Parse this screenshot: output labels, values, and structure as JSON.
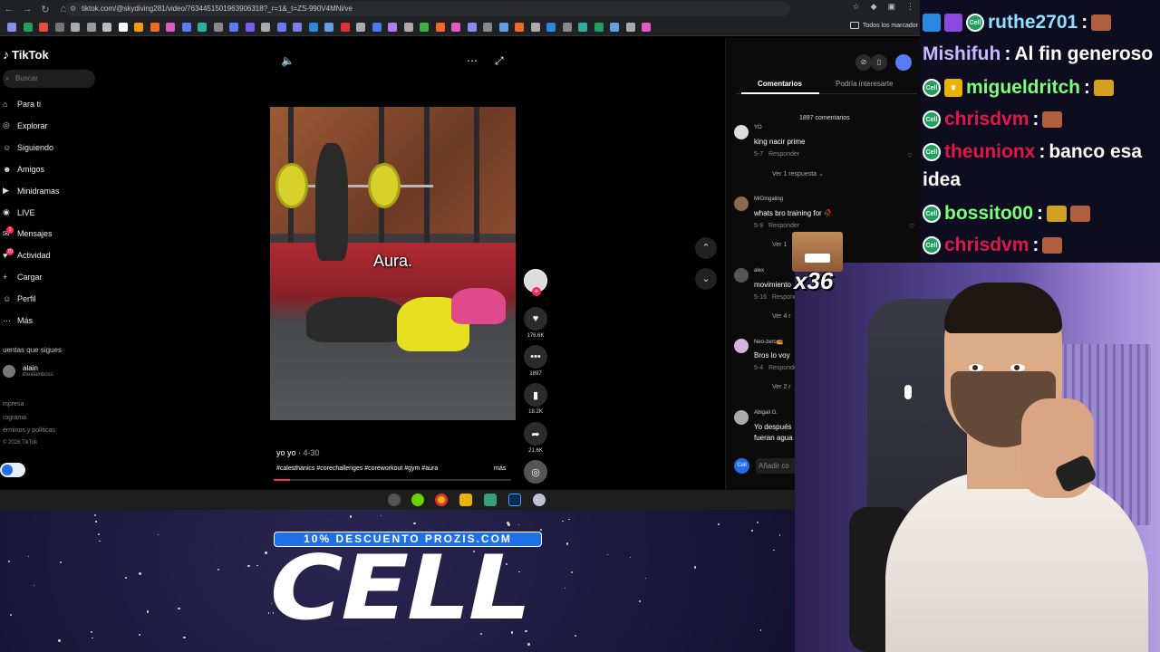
{
  "browser": {
    "url": "tiktok.com/@skydiving281/video/7634451501963906318?_r=1&_t=ZS-990V4MNi/ve",
    "bookmarks_folder": "Todos los marcador",
    "bookmark_colors": [
      "#8a8cf0",
      "#1fa05c",
      "#e74c3c",
      "#777",
      "#aaa",
      "#999",
      "#bbb",
      "#fff",
      "#f39c12",
      "#f06a24",
      "#e05cc0",
      "#5b7cfa",
      "#2bb0a0",
      "#888",
      "#5b7cfa",
      "#7a5cf0",
      "#aaa",
      "#6a7cf0",
      "#7a7cf0",
      "#2a8adf",
      "#5fa0e8",
      "#d33",
      "#aaa",
      "#4a7cf0",
      "#b07cf0",
      "#aaa",
      "#40b040",
      "#f06a24",
      "#e05cc0",
      "#8a8cf0",
      "#888",
      "#5fa0e8",
      "#f06a24",
      "#aaa",
      "#2a8adf",
      "#888",
      "#2bb0a0",
      "#1fa05c",
      "#5fa0e8",
      "#aaa",
      "#e05cc0"
    ]
  },
  "sidebar": {
    "logo": "TikTok",
    "search_placeholder": "Buscar",
    "items": [
      {
        "label": "Para ti",
        "icon": "home-icon"
      },
      {
        "label": "Explorar",
        "icon": "compass-icon"
      },
      {
        "label": "Siguiendo",
        "icon": "user-follow-icon"
      },
      {
        "label": "Amigos",
        "icon": "friends-icon"
      },
      {
        "label": "Minidramas",
        "icon": "drama-icon"
      },
      {
        "label": "LIVE",
        "icon": "live-icon"
      },
      {
        "label": "Mensajes",
        "icon": "message-icon"
      },
      {
        "label": "Actividad",
        "icon": "activity-icon"
      },
      {
        "label": "Cargar",
        "icon": "upload-icon"
      },
      {
        "label": "Perfil",
        "icon": "profile-icon"
      },
      {
        "label": "Más",
        "icon": "more-icon"
      }
    ],
    "messages_badge": "1",
    "activity_badge": "20",
    "following_header": "uentas que sigues",
    "following_user": {
      "name": "alain",
      "handle": "thealainboss"
    },
    "footer": [
      "mpresa",
      "rograma",
      "érminos y políticas",
      "© 2026 TikTok"
    ]
  },
  "video": {
    "caption": "Aura.",
    "author": "yo yo",
    "date": "4-30",
    "hashtags": "#calesthanics #corechallenges #coreworkout #gym #aura",
    "more_label": "más",
    "progress": 0.07,
    "likes": "176.6K",
    "comments": "1897",
    "saves": "18.2K",
    "shares": "21.6K"
  },
  "comments_panel": {
    "tab_comments": "Comentarios",
    "tab_interest": "Podría interesarte",
    "count_label": "1897 comentarios",
    "reply_label": "Responder",
    "add_placeholder": "Añadir co",
    "items": [
      {
        "user": "YO",
        "text": "king nacir prime",
        "date": "5-7",
        "replies": "Ver 1 respuesta ⌄"
      },
      {
        "user": "MrDingaling",
        "text": "whats bro training for 🥀",
        "date": "5-9",
        "replies": "Ver 1"
      },
      {
        "user": "alex",
        "text": "movimiento",
        "date": "5-16",
        "replies": "Ver 4 r"
      },
      {
        "user": "Neo-zero📻",
        "text": "Bros lo voy",
        "date": "5-4",
        "replies": "Ver 2 r"
      },
      {
        "user": "Abigail G.",
        "text": "Yo después",
        "text2": "fueran agua",
        "date": "",
        "replies": ""
      }
    ]
  },
  "overlay": {
    "emote_count": "x36",
    "promo_band": "10% DESCUENTO PROZIS.COM",
    "promo_big": "CELL"
  },
  "chat": {
    "messages": [
      {
        "user": "ruthe2701",
        "sep": " :",
        "text": "",
        "color": "#8fe0ff"
      },
      {
        "user": "Mishifuh",
        "sep": " :",
        "text": " Al fin generoso",
        "color": "#c8b8ff"
      },
      {
        "user": "migueldritch",
        "sep": " :",
        "text": "",
        "color": "#7cff7c"
      },
      {
        "user": "chrisdvm",
        "sep": " :",
        "text": "",
        "color": "#e0184a"
      },
      {
        "user": "theunionx",
        "sep": " :",
        "text": " banco esa",
        "color": "#e0184a"
      },
      {
        "user": "",
        "sep": "",
        "text": "idea",
        "color": "#ffffff"
      },
      {
        "user": "bossito00",
        "sep": " :",
        "text": "",
        "color": "#7cff7c"
      },
      {
        "user": "chrisdvm",
        "sep": " :",
        "text": "",
        "color": "#e0184a"
      }
    ]
  }
}
